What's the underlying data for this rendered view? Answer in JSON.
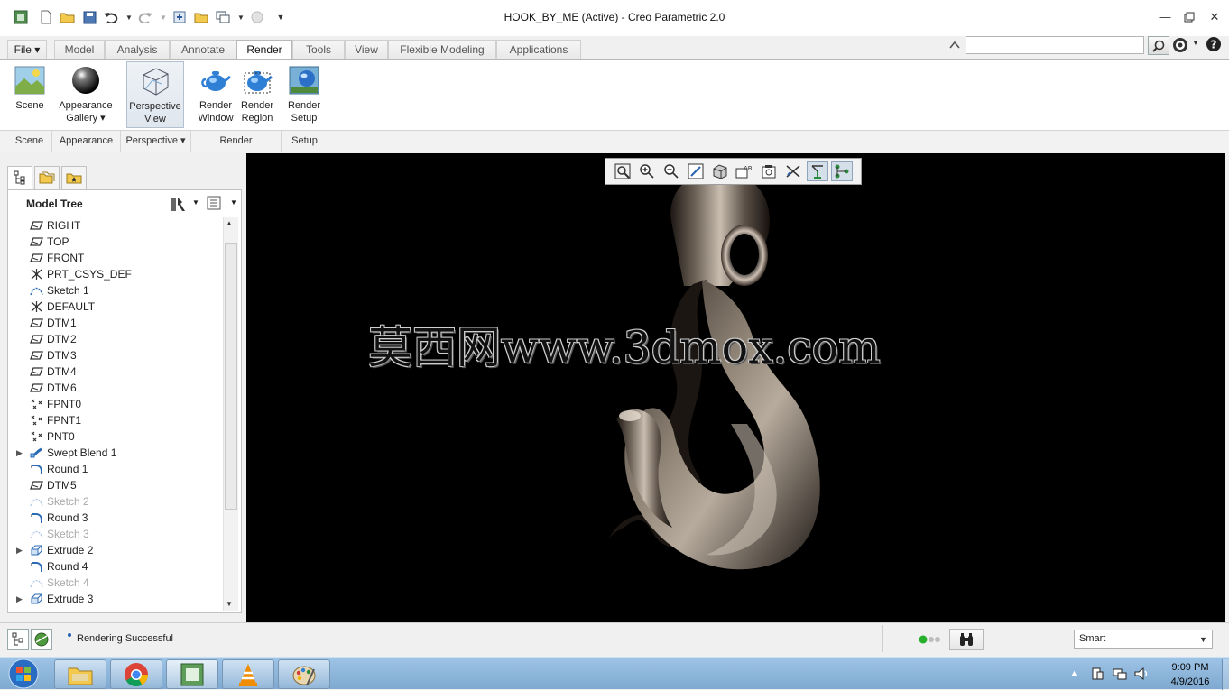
{
  "window": {
    "title": "HOOK_BY_ME (Active) - Creo Parametric 2.0"
  },
  "quick_access": [
    "new-icon",
    "open-icon",
    "save-icon",
    "undo-icon",
    "redo-icon",
    "regenerate-icon",
    "windows-icon",
    "close-window-icon"
  ],
  "tabs": [
    {
      "label": "File ▾"
    },
    {
      "label": "Model"
    },
    {
      "label": "Analysis"
    },
    {
      "label": "Annotate"
    },
    {
      "label": "Render"
    },
    {
      "label": "Tools"
    },
    {
      "label": "View"
    },
    {
      "label": "Flexible Modeling"
    },
    {
      "label": "Applications"
    }
  ],
  "active_tab": "Render",
  "search": {
    "value": "",
    "placeholder": ""
  },
  "ribbon": {
    "scene": "Scene",
    "appearance_1": "Appearance",
    "appearance_2": "Gallery ▾",
    "perspective_1": "Perspective",
    "perspective_2": "View",
    "render_window_1": "Render",
    "render_window_2": "Window",
    "render_region_1": "Render",
    "render_region_2": "Region",
    "render_setup_1": "Render",
    "render_setup_2": "Setup"
  },
  "groups": {
    "scene": "Scene",
    "appearance": "Appearance",
    "perspective": "Perspective ▾",
    "render": "Render",
    "setup": "Setup"
  },
  "model_tree": {
    "title": "Model Tree",
    "items": [
      {
        "label": "RIGHT",
        "icon": "datum-plane-icon"
      },
      {
        "label": "TOP",
        "icon": "datum-plane-icon"
      },
      {
        "label": "FRONT",
        "icon": "datum-plane-icon"
      },
      {
        "label": "PRT_CSYS_DEF",
        "icon": "csys-icon"
      },
      {
        "label": "Sketch 1",
        "icon": "sketch-icon"
      },
      {
        "label": "DEFAULT",
        "icon": "csys-icon"
      },
      {
        "label": "DTM1",
        "icon": "datum-plane-icon"
      },
      {
        "label": "DTM2",
        "icon": "datum-plane-icon"
      },
      {
        "label": "DTM3",
        "icon": "datum-plane-icon"
      },
      {
        "label": "DTM4",
        "icon": "datum-plane-icon"
      },
      {
        "label": "DTM6",
        "icon": "datum-plane-icon"
      },
      {
        "label": "FPNT0",
        "icon": "datum-point-icon"
      },
      {
        "label": "FPNT1",
        "icon": "datum-point-icon"
      },
      {
        "label": "PNT0",
        "icon": "datum-point-icon"
      },
      {
        "label": "Swept Blend 1",
        "icon": "swept-blend-icon",
        "expandable": true
      },
      {
        "label": "Round 1",
        "icon": "round-icon"
      },
      {
        "label": "DTM5",
        "icon": "datum-plane-icon"
      },
      {
        "label": "Sketch 2",
        "icon": "sketch-icon",
        "dim": true
      },
      {
        "label": "Round 3",
        "icon": "round-icon"
      },
      {
        "label": "Sketch 3",
        "icon": "sketch-icon",
        "dim": true
      },
      {
        "label": "Extrude 2",
        "icon": "extrude-icon",
        "expandable": true
      },
      {
        "label": "Round 4",
        "icon": "round-icon"
      },
      {
        "label": "Sketch 4",
        "icon": "sketch-icon",
        "dim": true
      },
      {
        "label": "Extrude 3",
        "icon": "extrude-icon",
        "expandable": true
      }
    ]
  },
  "watermark": "莫西网www.3dmox.com",
  "status": {
    "message": "Rendering Successful",
    "filter": "Smart"
  },
  "taskbar": {
    "time": "9:09 PM",
    "date": "4/9/2016"
  },
  "colors": {
    "accent": "#3b6ea5",
    "viewport_bg": "#000000",
    "hook": "#6b5f54"
  }
}
